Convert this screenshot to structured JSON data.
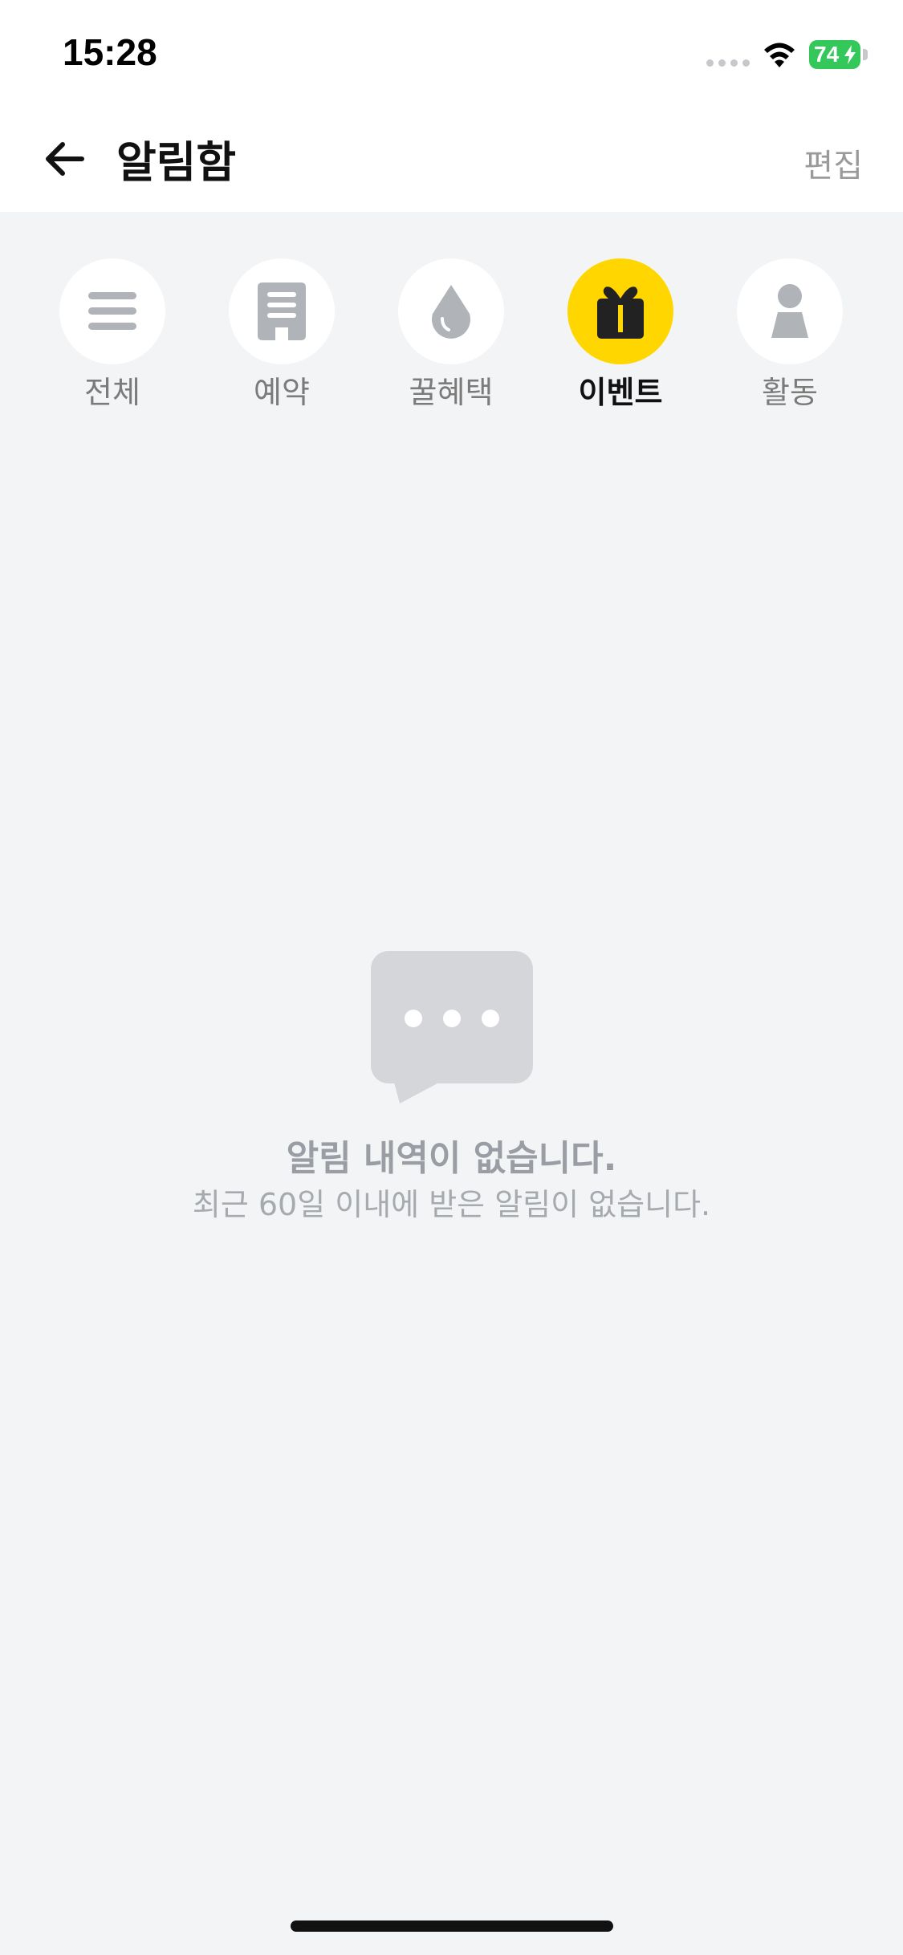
{
  "status_bar": {
    "time": "15:28",
    "battery": "74"
  },
  "header": {
    "title": "알림함",
    "edit_label": "편집"
  },
  "categories": [
    {
      "label": "전체",
      "icon": "menu-icon",
      "active": false
    },
    {
      "label": "예약",
      "icon": "receipt-icon",
      "active": false
    },
    {
      "label": "꿀혜택",
      "icon": "droplet-icon",
      "active": false
    },
    {
      "label": "이벤트",
      "icon": "gift-icon",
      "active": true
    },
    {
      "label": "활동",
      "icon": "person-icon",
      "active": false
    }
  ],
  "empty_state": {
    "icon": "chat-bubble-icon",
    "title": "알림 내역이 없습니다.",
    "subtitle": "최근 60일 이내에 받은 알림이 없습니다."
  },
  "colors": {
    "accent": "#ffd600",
    "background": "#f3f4f6",
    "icon_gray": "#b0b3b8"
  }
}
